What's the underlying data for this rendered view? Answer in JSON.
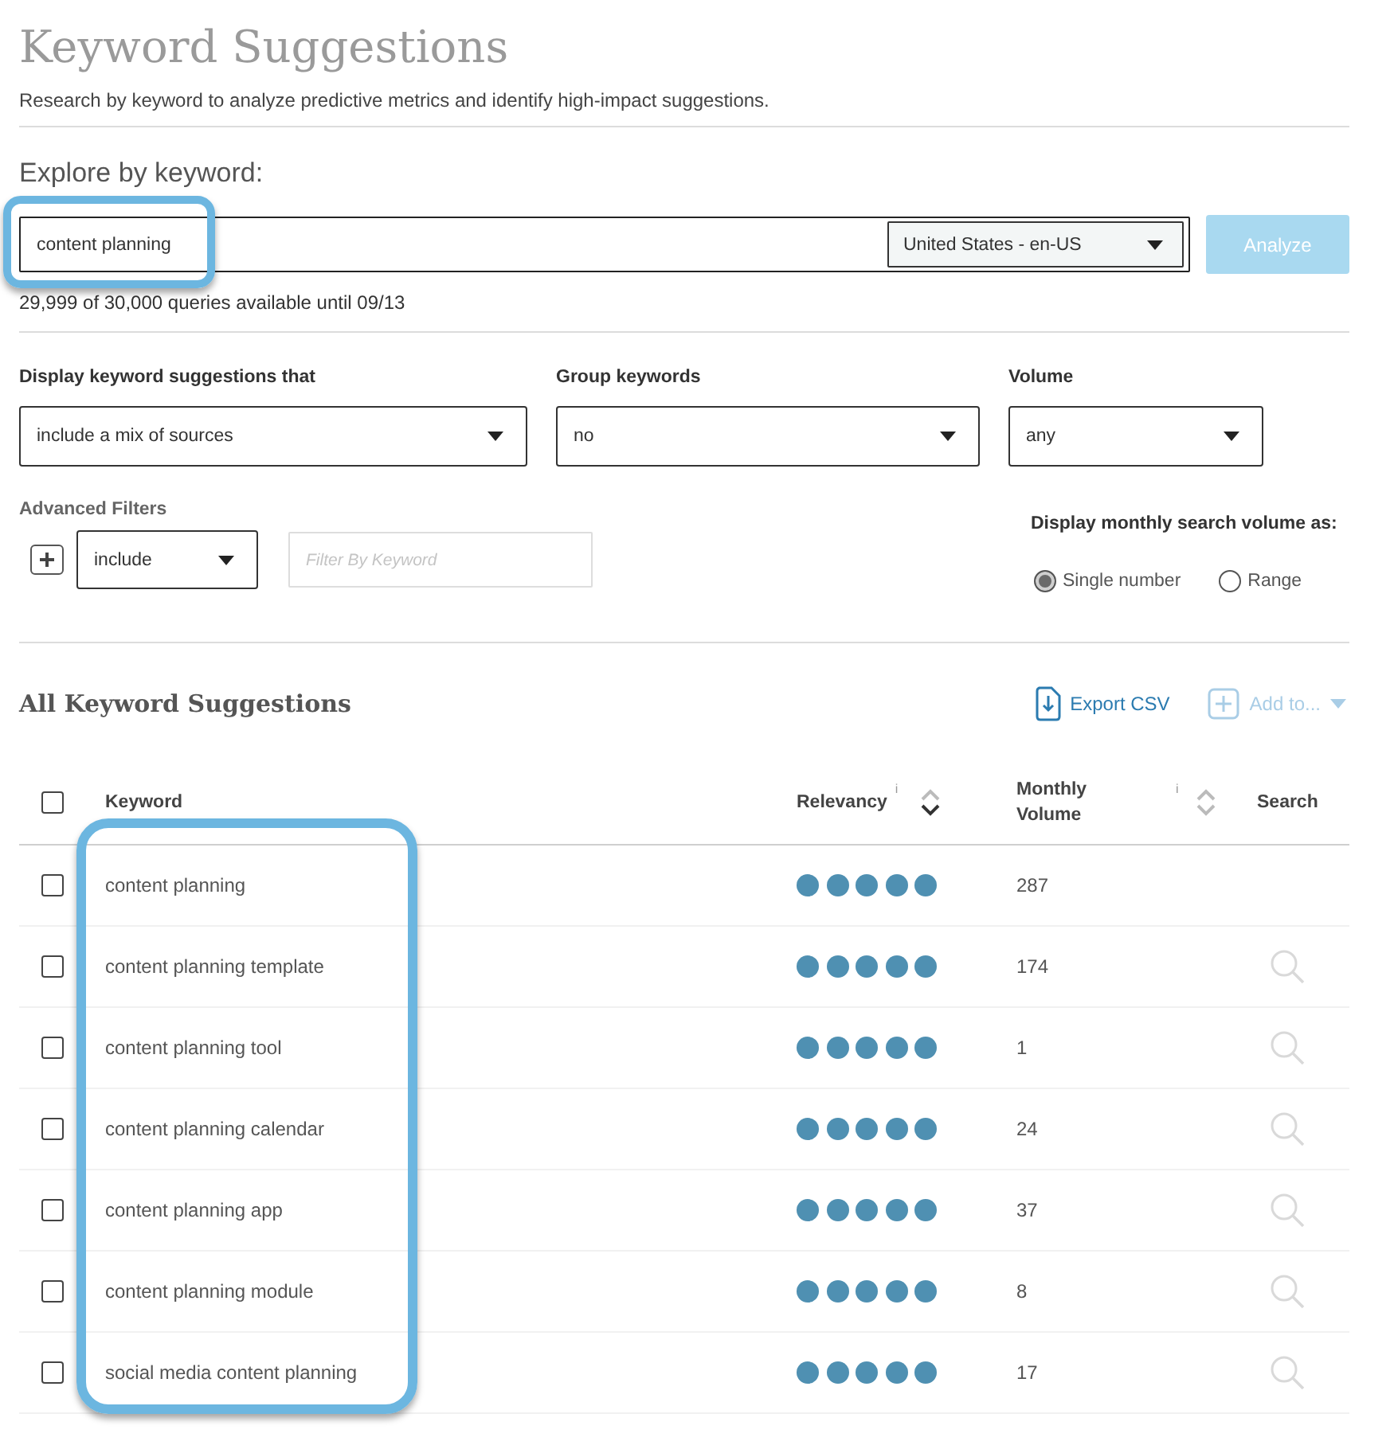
{
  "header": {
    "title": "Keyword Suggestions",
    "subtitle": "Research by keyword to analyze predictive metrics and identify high-impact suggestions."
  },
  "explore": {
    "label": "Explore by keyword:",
    "keyword": {
      "value": "content planning",
      "highlighted": true
    },
    "country": "United States - en-US",
    "analyze": {
      "label": "Analyze",
      "disabled": true
    },
    "quota": "29,999 of 30,000 queries available until 09/13"
  },
  "filters": {
    "selects": [
      {
        "label": "Display keyword suggestions that",
        "value": "include a mix of sources"
      },
      {
        "label": "Group keywords",
        "value": "no"
      },
      {
        "label": "Volume",
        "value": "any"
      }
    ],
    "advanced": {
      "label": "Advanced Filters",
      "mode": "include",
      "keyword_filter": {
        "placeholder": "Filter By Keyword"
      }
    },
    "volume_display": {
      "label": "Display monthly search volume as:",
      "options": [
        {
          "label": "Single number",
          "selected": true
        },
        {
          "label": "Range",
          "selected": false
        }
      ]
    }
  },
  "results": {
    "title": "All Keyword Suggestions",
    "actions": [
      {
        "label": "Export CSV",
        "kind": "export",
        "disabled": false
      },
      {
        "label": "Add to...",
        "kind": "add",
        "disabled": true
      }
    ],
    "table": {
      "select_all_checked": false,
      "columns": [
        {
          "label": "Keyword",
          "highlighted": true
        },
        {
          "label": "Relevancy",
          "info": "i",
          "sortable": true,
          "sorted": true
        },
        {
          "label": "Monthly Volume",
          "info": "i",
          "sortable": true,
          "sorted": false
        },
        {
          "label": "Search"
        }
      ],
      "rows": [
        {
          "keyword": "content planning",
          "checked": false,
          "stars": 5,
          "volume": "287",
          "search_shown": false
        },
        {
          "keyword": "content planning template",
          "checked": false,
          "stars": 5,
          "volume": "174",
          "search_shown": true
        },
        {
          "keyword": "content planning tool",
          "checked": false,
          "stars": 5,
          "volume": "1",
          "search_shown": true
        },
        {
          "keyword": "content planning calendar",
          "checked": false,
          "stars": 5,
          "volume": "24",
          "search_shown": true
        },
        {
          "keyword": "content planning app",
          "checked": false,
          "stars": 5,
          "volume": "37",
          "search_shown": true
        },
        {
          "keyword": "content planning module",
          "checked": false,
          "stars": 5,
          "volume": "8",
          "search_shown": true
        },
        {
          "keyword": "social media content planning",
          "checked": false,
          "stars": 5,
          "volume": "17",
          "search_shown": true
        }
      ]
    }
  }
}
